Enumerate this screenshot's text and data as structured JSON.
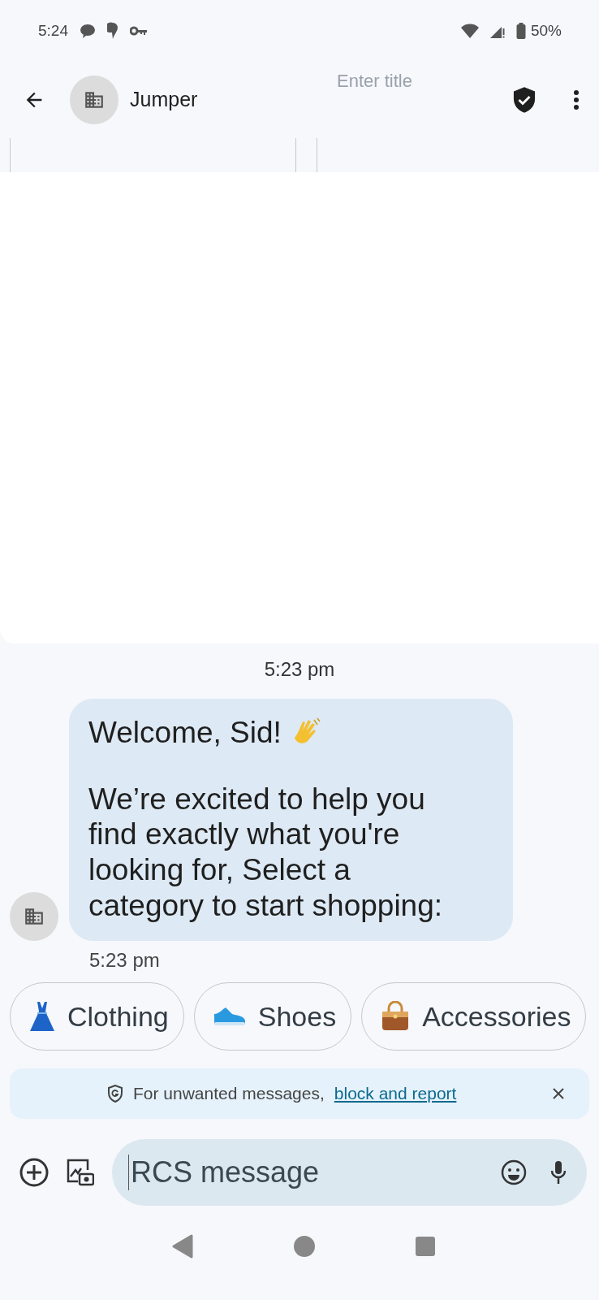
{
  "status_bar": {
    "time": "5:24",
    "battery": "50%"
  },
  "header": {
    "title": "Jumper",
    "ghost_title": "Enter title"
  },
  "conversation": {
    "date_stamp": "5:23 pm",
    "message": {
      "greeting": "Welcome, Sid!",
      "body": "We’re excited to help you find exactly what you're looking for, Select a category to start shopping:",
      "time": "5:23 pm"
    },
    "suggestions": [
      {
        "label": "Clothing",
        "kind": "dress"
      },
      {
        "label": "Shoes",
        "kind": "shoe"
      },
      {
        "label": "Accessories",
        "kind": "bag"
      }
    ]
  },
  "banner": {
    "text": "For unwanted messages,",
    "link": "block and report"
  },
  "composer": {
    "placeholder": "RCS message"
  }
}
